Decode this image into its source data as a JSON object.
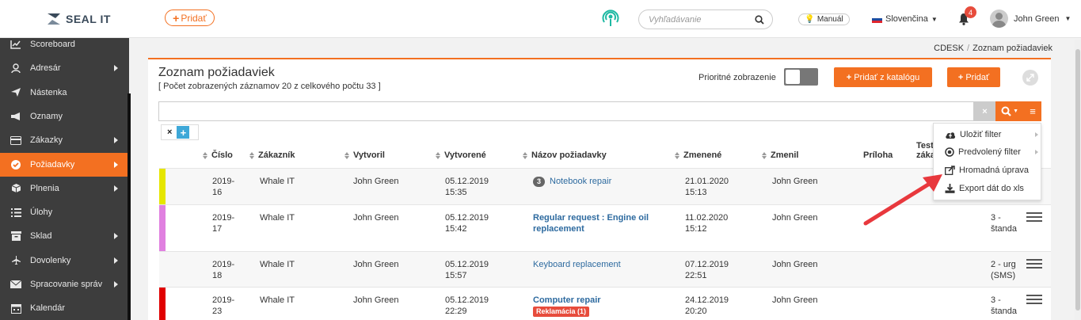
{
  "header": {
    "logo_text": "SEAL IT",
    "add_button": "Pridať",
    "search_placeholder": "Vyhľadávanie",
    "manual": "Manuál",
    "language": "Slovenčina",
    "notifications_count": "4",
    "user_name": "John Green"
  },
  "sidebar": {
    "items": [
      {
        "label": "Scoreboard",
        "icon": "chart-line-icon",
        "has_submenu": false,
        "active": false
      },
      {
        "label": "Adresár",
        "icon": "user-icon",
        "has_submenu": true,
        "active": false
      },
      {
        "label": "Nástenka",
        "icon": "paper-plane-icon",
        "has_submenu": false,
        "active": false
      },
      {
        "label": "Oznamy",
        "icon": "megaphone-icon",
        "has_submenu": false,
        "active": false
      },
      {
        "label": "Zákazky",
        "icon": "credit-card-icon",
        "has_submenu": true,
        "active": false
      },
      {
        "label": "Požiadavky",
        "icon": "gear-icon",
        "has_submenu": true,
        "active": true
      },
      {
        "label": "Plnenia",
        "icon": "cube-icon",
        "has_submenu": true,
        "active": false
      },
      {
        "label": "Úlohy",
        "icon": "list-icon",
        "has_submenu": false,
        "active": false
      },
      {
        "label": "Sklad",
        "icon": "archive-icon",
        "has_submenu": true,
        "active": false
      },
      {
        "label": "Dovolenky",
        "icon": "plane-icon",
        "has_submenu": true,
        "active": false
      },
      {
        "label": "Spracovanie správ",
        "icon": "envelope-icon",
        "has_submenu": true,
        "active": false
      },
      {
        "label": "Kalendár",
        "icon": "calendar-icon",
        "has_submenu": false,
        "active": false
      }
    ]
  },
  "breadcrumb": {
    "root": "CDESK",
    "separator": "/",
    "current": "Zoznam požiadaviek"
  },
  "main": {
    "title": "Zoznam požiadaviek",
    "subtitle": "[ Počet zobrazených záznamov 20 z celkového počtu 33 ]",
    "priority_label": "Prioritné zobrazenie",
    "add_from_catalog": "Pridať z katalógu",
    "add": "Pridať"
  },
  "table": {
    "columns": [
      "Číslo",
      "Zákazník",
      "Vytvoril",
      "Vytvorené",
      "Názov požiadavky",
      "Zmenené",
      "Zmenil",
      "Príloha",
      "Test",
      "záka"
    ],
    "rows": [
      {
        "strip": "#e6e600",
        "number": [
          "2019-",
          "16"
        ],
        "customer": "Whale IT",
        "creator": "John Green",
        "created": [
          "05.12.2019",
          "15:35"
        ],
        "count": "3",
        "title": [
          "Notebook repair"
        ],
        "title_style": "link",
        "changed": [
          "21.01.2020",
          "15:13"
        ],
        "changer": "John Green",
        "extra": [
          "",
          ""
        ],
        "badge": ""
      },
      {
        "strip": "#e080e0",
        "number": [
          "2019-",
          "17"
        ],
        "customer": "Whale IT",
        "creator": "John Green",
        "created": [
          "05.12.2019",
          "15:42"
        ],
        "count": "",
        "title": [
          "Regular request : Engine oil",
          "replacement"
        ],
        "title_style": "bold",
        "changed": [
          "11.02.2020",
          "15:12"
        ],
        "changer": "John Green",
        "extra": [
          "3 -",
          "štanda"
        ],
        "badge": ""
      },
      {
        "strip": "",
        "number": [
          "2019-",
          "18"
        ],
        "customer": "Whale IT",
        "creator": "John Green",
        "created": [
          "05.12.2019",
          "15:57"
        ],
        "count": "",
        "title": [
          "Keyboard replacement"
        ],
        "title_style": "link",
        "changed": [
          "07.12.2019",
          "22:51"
        ],
        "changer": "John Green",
        "extra": [
          "2 - urg",
          "(SMS)"
        ],
        "badge": ""
      },
      {
        "strip": "#e00000",
        "number": [
          "2019-",
          "23"
        ],
        "customer": "Whale IT",
        "creator": "John Green",
        "created": [
          "05.12.2019",
          "22:29"
        ],
        "count": "",
        "title": [
          "Computer repair"
        ],
        "title_style": "bold",
        "changed": [
          "24.12.2019",
          "20:20"
        ],
        "changer": "John Green",
        "extra": [
          "3 -",
          "štanda"
        ],
        "badge": "Reklamácia (1)"
      }
    ]
  },
  "dropdown_menu": {
    "items": [
      {
        "label": "Uložiť filter",
        "icon": "cloud-upload-icon",
        "has_submenu": true
      },
      {
        "label": "Predvolený filter",
        "icon": "dot-circle-icon",
        "has_submenu": true
      },
      {
        "label": "Hromadná úprava",
        "icon": "share-square-icon",
        "has_submenu": false
      },
      {
        "label": "Export dát do xls",
        "icon": "download-icon",
        "has_submenu": false
      }
    ]
  },
  "colors": {
    "accent": "#f37021",
    "sidebar": "#3d3d3d",
    "arrow": "#e8383d"
  }
}
